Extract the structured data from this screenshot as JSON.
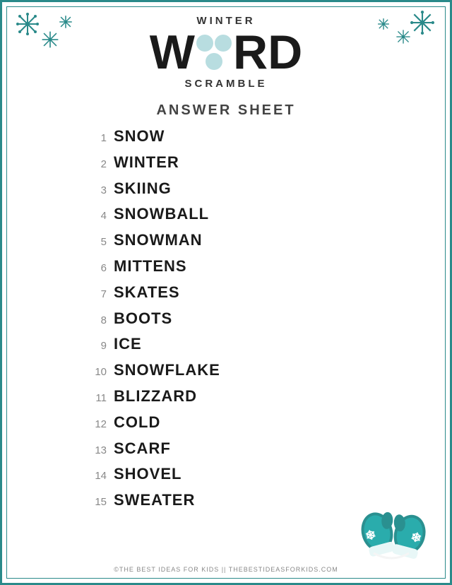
{
  "header": {
    "winter": "WINTER",
    "scramble": "SCRAMBLE"
  },
  "answer_sheet_title": "ANSWER SHEET",
  "words": [
    {
      "number": "1",
      "word": "SNOW"
    },
    {
      "number": "2",
      "word": "WINTER"
    },
    {
      "number": "3",
      "word": "SKIING"
    },
    {
      "number": "4",
      "word": "SNOWBALL"
    },
    {
      "number": "5",
      "word": "SNOWMAN"
    },
    {
      "number": "6",
      "word": "MITTENS"
    },
    {
      "number": "7",
      "word": "SKATES"
    },
    {
      "number": "8",
      "word": "BOOTS"
    },
    {
      "number": "9",
      "word": "ICE"
    },
    {
      "number": "10",
      "word": "SNOWFLAKE"
    },
    {
      "number": "11",
      "word": "BLIZZARD"
    },
    {
      "number": "12",
      "word": "COLD"
    },
    {
      "number": "13",
      "word": "SCARF"
    },
    {
      "number": "14",
      "word": "SHOVEL"
    },
    {
      "number": "15",
      "word": "SWEATER"
    }
  ],
  "footer": "©THE BEST IDEAS FOR KIDS || THEBESTIDEASFORKIDS.COM",
  "colors": {
    "teal": "#2a8a8a",
    "dark": "#1a1a1a",
    "bubble": "#b8dde0"
  }
}
